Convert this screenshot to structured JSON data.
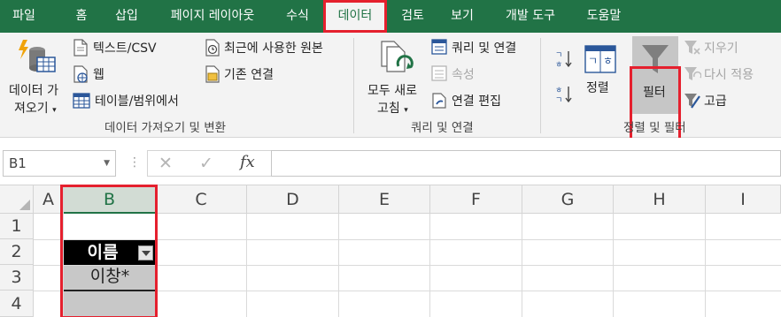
{
  "tabs": [
    {
      "label": "파일",
      "active": false
    },
    {
      "label": "홈",
      "active": false
    },
    {
      "label": "삽입",
      "active": false
    },
    {
      "label": "페이지 레이아웃",
      "active": false
    },
    {
      "label": "수식",
      "active": false
    },
    {
      "label": "데이터",
      "active": true
    },
    {
      "label": "검토",
      "active": false
    },
    {
      "label": "보기",
      "active": false
    },
    {
      "label": "개발 도구",
      "active": false
    },
    {
      "label": "도움말",
      "active": false
    }
  ],
  "ribbon": {
    "get_data": {
      "big_button_line1": "데이터 가",
      "big_button_line2": "져오기",
      "text_csv": "텍스트/CSV",
      "web": "웹",
      "table_range": "테이블/범위에서",
      "recent_sources": "최근에 사용한 원본",
      "existing_connections": "기존 연결",
      "group_label": "데이터 가져오기 및 변환"
    },
    "queries": {
      "refresh_line1": "모두 새로",
      "refresh_line2": "고침",
      "queries_connections": "쿼리 및 연결",
      "properties": "속성",
      "edit_links": "연결 편집",
      "group_label": "쿼리 및 연결"
    },
    "sort_filter": {
      "sort": "정렬",
      "filter": "필터",
      "clear": "지우기",
      "reapply": "다시 적용",
      "advanced": "고급",
      "group_label": "정렬 및 필터"
    }
  },
  "formula_bar": {
    "name_box": "B1",
    "formula": ""
  },
  "sheet": {
    "columns": [
      "A",
      "B",
      "C",
      "D",
      "E",
      "F",
      "G",
      "H",
      "I"
    ],
    "selected_column": "B",
    "rows": [
      "1",
      "2",
      "3",
      "4"
    ],
    "cells": {
      "B2": "이름",
      "B3": "이창*"
    }
  },
  "colors": {
    "excel_green": "#217346",
    "highlight_red": "#e5202e",
    "header_cell_fill": "#000000",
    "filtered_cell_fill": "#c8c8c8"
  }
}
